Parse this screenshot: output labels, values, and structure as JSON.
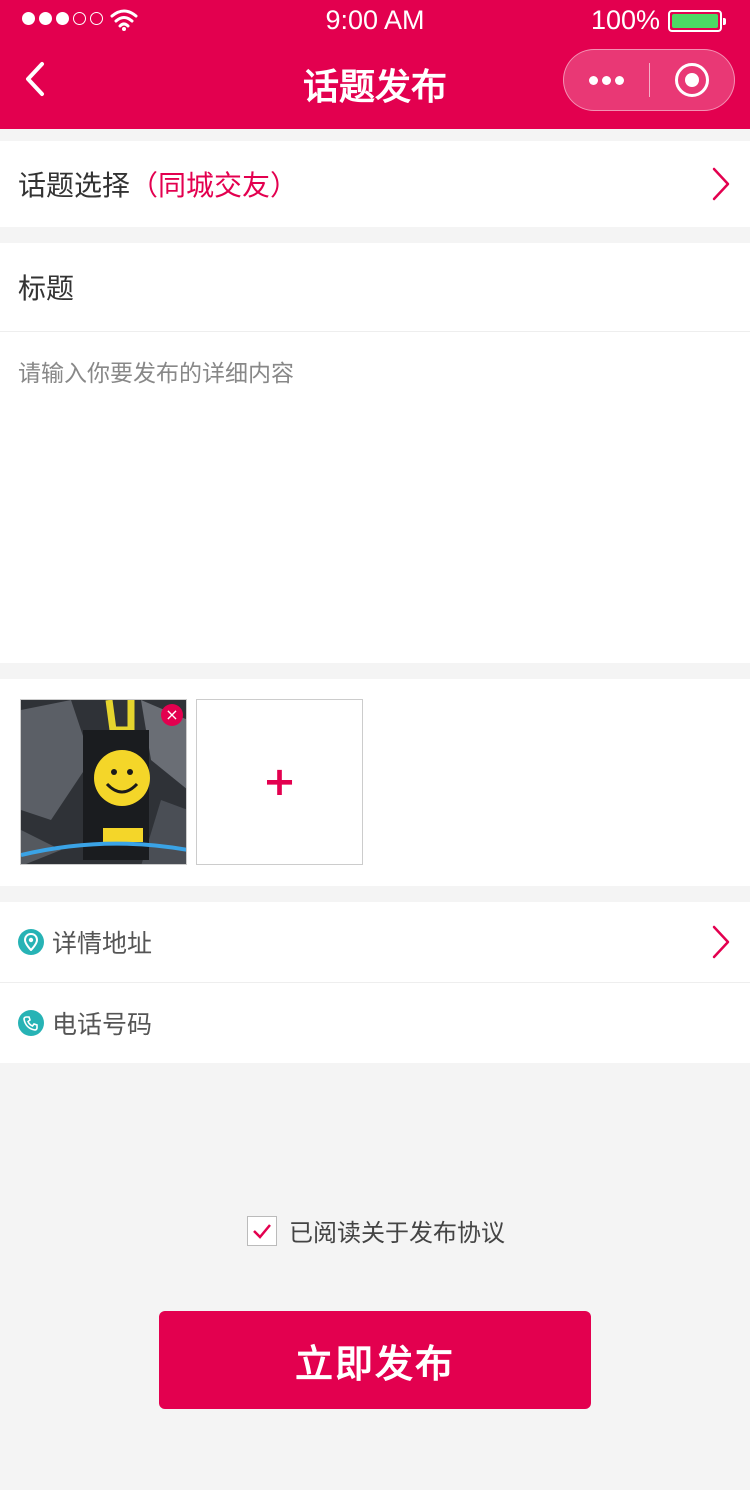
{
  "status_bar": {
    "time": "9:00 AM",
    "battery": "100%",
    "battery_level": 1.0
  },
  "nav": {
    "title": "话题发布"
  },
  "topic": {
    "label": "话题选择",
    "selected": "（同城交友）"
  },
  "form": {
    "title_label": "标题",
    "content_placeholder": "请输入你要发布的详细内容"
  },
  "photos": {
    "add_symbol": "+",
    "remove_symbol": "×"
  },
  "info": {
    "address_label": "详情地址",
    "phone_label": "电话号码"
  },
  "agreement": {
    "checked": true,
    "text": "已阅读关于发布协议"
  },
  "submit_label": "立即发布",
  "colors": {
    "brand": "#e3004f",
    "icon_teal": "#27b3b5",
    "battery_green": "#4cd964"
  },
  "icons": [
    "back-icon",
    "more-icon",
    "close-mini-program-icon",
    "chevron-right-icon",
    "location-pin-icon",
    "phone-icon",
    "checkmark-icon",
    "remove-photo-icon",
    "add-photo-icon"
  ]
}
